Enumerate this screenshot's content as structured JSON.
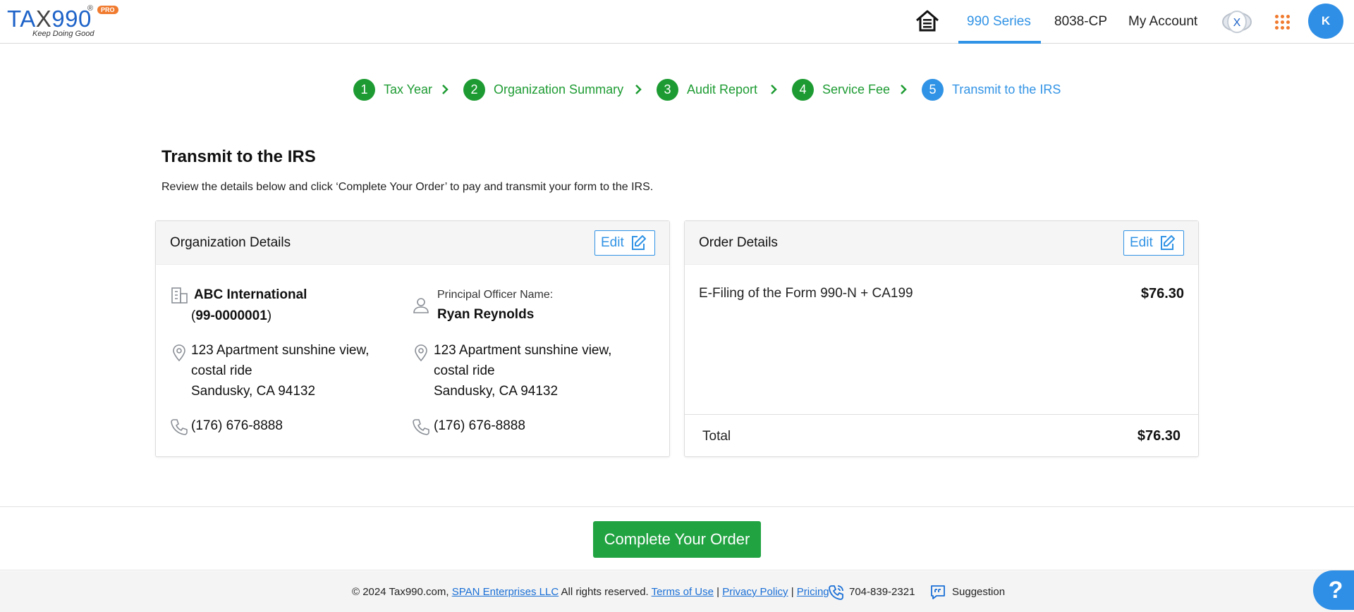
{
  "logo": {
    "brand_a": "TA",
    "brand_x": "X",
    "brand_b": "990",
    "reg": "®",
    "pro": "PRO",
    "tagline": "Keep Doing Good"
  },
  "nav": {
    "items": [
      {
        "label": "990 Series",
        "active": true
      },
      {
        "label": "8038-CP",
        "active": false
      },
      {
        "label": "My Account",
        "active": false
      }
    ],
    "badge_letter": "X",
    "avatar_initial": "K"
  },
  "stepper": {
    "steps": [
      {
        "num": "1",
        "label": "Tax Year",
        "status": "done"
      },
      {
        "num": "2",
        "label": "Organization Summary",
        "status": "done"
      },
      {
        "num": "3",
        "label": "Audit Report",
        "status": "done"
      },
      {
        "num": "4",
        "label": "Service Fee",
        "status": "done"
      },
      {
        "num": "5",
        "label": "Transmit to the IRS",
        "status": "current"
      }
    ]
  },
  "page": {
    "title": "Transmit to the IRS",
    "subtitle": "Review the details below and click ‘Complete Your Order’ to pay and transmit your form to the IRS."
  },
  "org_card": {
    "title": "Organization Details",
    "edit_label": "Edit",
    "org_name": "ABC International",
    "ein_open": "(",
    "ein": "99-0000001",
    "ein_close": ")",
    "org_address_line1": "123 Apartment sunshine view,",
    "org_address_line2": "costal ride",
    "org_address_line3": "Sandusky, CA 94132",
    "org_phone": "(176) 676-8888",
    "officer_label": "Principal Officer Name:",
    "officer_name": "Ryan Reynolds",
    "officer_address_line1": "123 Apartment sunshine view,",
    "officer_address_line2": "costal ride",
    "officer_address_line3": "Sandusky, CA 94132",
    "officer_phone": "(176) 676-8888"
  },
  "order_card": {
    "title": "Order Details",
    "edit_label": "Edit",
    "line_item": "E-Filing of the Form 990-N + CA199",
    "line_price": "$76.30",
    "total_label": "Total",
    "total_value": "$76.30"
  },
  "action": {
    "complete_label": "Complete Your Order"
  },
  "footer": {
    "copyright": "© 2024 Tax990.com, ",
    "company_link": "SPAN Enterprises LLC",
    "rights": " All rights reserved. ",
    "terms": "Terms of Use",
    "sep1": " | ",
    "privacy": "Privacy Policy",
    "sep2": " | ",
    "pricing": "Pricing",
    "phone": "704-839-2321",
    "suggestion": "Suggestion"
  },
  "help": {
    "label": "?"
  },
  "colors": {
    "brand_blue": "#3193e5",
    "step_green": "#1d9b32",
    "button_green": "#21a342",
    "logo_orange": "#f07a2e"
  }
}
